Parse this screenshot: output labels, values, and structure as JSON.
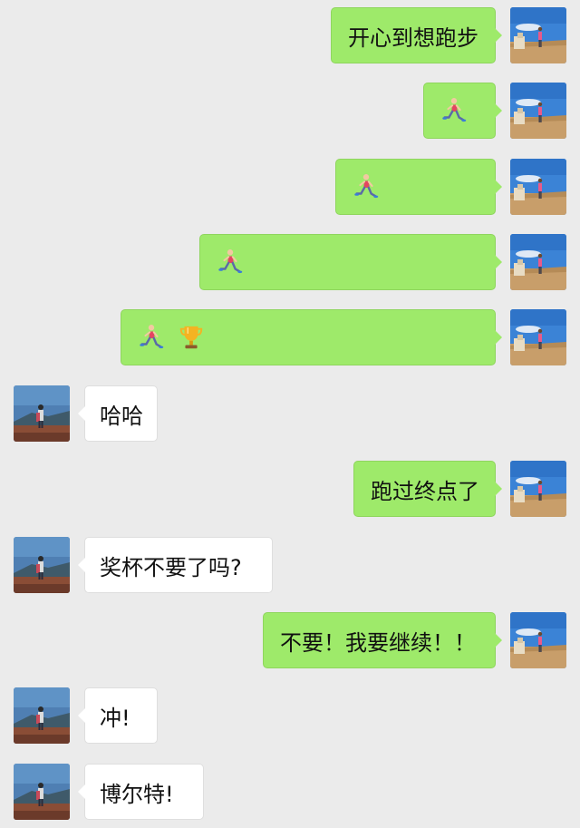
{
  "chat": {
    "messages": [
      {
        "from": "me",
        "kind": "text",
        "text": "开心到想跑步"
      },
      {
        "from": "me",
        "kind": "emoji",
        "emojis": [
          "runner-emoji"
        ]
      },
      {
        "from": "me",
        "kind": "emoji",
        "emojis": [
          "runner-emoji"
        ]
      },
      {
        "from": "me",
        "kind": "emoji",
        "emojis": [
          "runner-emoji"
        ]
      },
      {
        "from": "me",
        "kind": "emoji",
        "emojis": [
          "runner-emoji",
          "trophy-emoji"
        ]
      },
      {
        "from": "friend",
        "kind": "text",
        "text": "哈哈"
      },
      {
        "from": "me",
        "kind": "text",
        "text": "跑过终点了"
      },
      {
        "from": "friend",
        "kind": "text",
        "text": "奖杯不要了吗?"
      },
      {
        "from": "me",
        "kind": "text",
        "text": "不要！我要继续！！"
      },
      {
        "from": "friend",
        "kind": "text",
        "text": "冲!"
      },
      {
        "from": "friend",
        "kind": "text",
        "text": "博尔特!"
      }
    ]
  },
  "colors": {
    "background": "#ebebeb",
    "outgoing_bubble": "#9eea6a",
    "incoming_bubble": "#ffffff"
  }
}
